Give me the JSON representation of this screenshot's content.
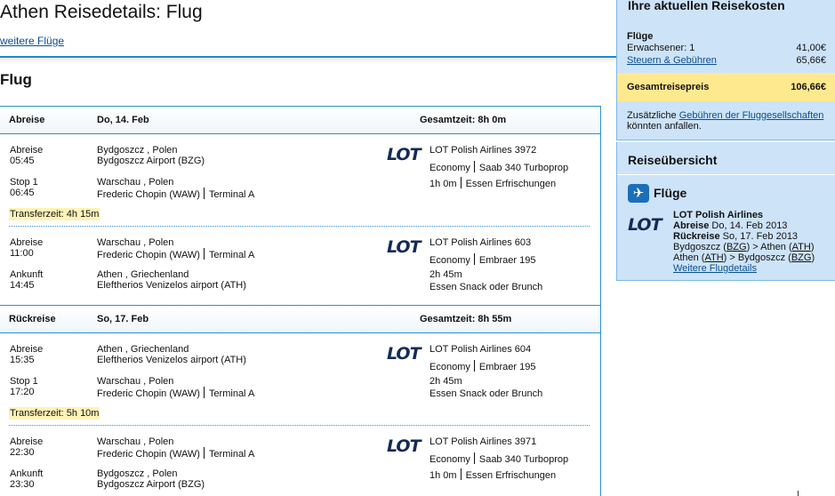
{
  "page": {
    "title": "Athen Reisedetails: Flug",
    "more_flights": "weitere Flüge",
    "section_title": "Flug"
  },
  "outbound": {
    "header": {
      "type": "Abreise",
      "date": "Do, 14. Feb",
      "total": "Gesamtzeit: 8h 0m"
    },
    "segments": [
      {
        "from_label": "Abreise",
        "from_time": "05:45",
        "from_city": "Bydgoszcz , Polen",
        "from_airport": "Bydgoszcz Airport (BZG)",
        "from_terminal": "",
        "to_label": "Stop 1",
        "to_time": "06:45",
        "to_city": "Warschau , Polen",
        "to_airport": "Frederic Chopin (WAW)",
        "to_terminal": "Terminal A",
        "airline": "LOT",
        "flight": "LOT Polish Airlines 3972",
        "class": "Economy",
        "aircraft": "Saab 340 Turboprop",
        "duration": "1h 0m",
        "meal": "Essen Erfrischungen"
      },
      {
        "from_label": "Abreise",
        "from_time": "11:00",
        "from_city": "Warschau , Polen",
        "from_airport": "Frederic Chopin (WAW)",
        "from_terminal": "Terminal A",
        "to_label": "Ankunft",
        "to_time": "14:45",
        "to_city": "Athen , Griechenland",
        "to_airport": "Eleftherios Venizelos airport (ATH)",
        "to_terminal": "",
        "airline": "LOT",
        "flight": "LOT Polish Airlines 603",
        "class": "Economy",
        "aircraft": "Embraer 195",
        "duration": "2h 45m",
        "meal": "Essen Snack oder Brunch"
      }
    ],
    "transfer": "Transferzeit: 4h 15m"
  },
  "return": {
    "header": {
      "type": "Rückreise",
      "date": "So, 17. Feb",
      "total": "Gesamtzeit: 8h 55m"
    },
    "segments": [
      {
        "from_label": "Abreise",
        "from_time": "15:35",
        "from_city": "Athen , Griechenland",
        "from_airport": "Eleftherios Venizelos airport (ATH)",
        "from_terminal": "",
        "to_label": "Stop 1",
        "to_time": "17:20",
        "to_city": "Warschau , Polen",
        "to_airport": "Frederic Chopin (WAW)",
        "to_terminal": "Terminal A",
        "airline": "LOT",
        "flight": "LOT Polish Airlines 604",
        "class": "Economy",
        "aircraft": "Embraer 195",
        "duration": "2h 45m",
        "meal": "Essen Snack oder Brunch"
      },
      {
        "from_label": "Abreise",
        "from_time": "22:30",
        "from_city": "Warschau , Polen",
        "from_airport": "Frederic Chopin (WAW)",
        "from_terminal": "Terminal A",
        "to_label": "Ankunft",
        "to_time": "23:30",
        "to_city": "Bydgoszcz , Polen",
        "to_airport": "Bydgoszcz Airport (BZG)",
        "to_terminal": "",
        "airline": "LOT",
        "flight": "LOT Polish Airlines 3971",
        "class": "Economy",
        "aircraft": "Saab 340 Turboprop",
        "duration": "1h 0m",
        "meal": "Essen Erfrischungen"
      }
    ],
    "transfer": "Transferzeit: 5h 10m"
  },
  "costs": {
    "title": "Ihre aktuellen Reisekosten",
    "flights_heading": "Flüge",
    "adults_label": "Erwachsener: 1",
    "adults_value": "41,00€",
    "taxes_link": "Steuern & Gebühren",
    "taxes_value": "65,66€",
    "total_label": "Gesamtreisepreis",
    "total_value": "106,66€",
    "extra_prefix": "Zusätzliche",
    "extra_link": "Gebühren der Fluggesellschaften",
    "extra_suffix": "könnten anfallen."
  },
  "overview": {
    "title": "Reiseübersicht",
    "flights_label": "Flüge",
    "airline_logo": "LOT",
    "airline_name": "LOT Polish Airlines",
    "depart_label": "Abreise",
    "depart_date": "Do, 14. Feb 2013",
    "return_label": "Rückreise",
    "return_date": "So, 17. Feb 2013",
    "route1_from": "Bydgoszcz",
    "route1_from_code": "BZG",
    "route1_to": "Athen",
    "route1_to_code": "ATH",
    "route2_from": "Athen",
    "route2_from_code": "ATH",
    "route2_to": "Bydgoszcz",
    "route2_to_code": "BZG",
    "details_link": "Weitere Flugdetails"
  },
  "icons": {
    "plane": "airplane-icon",
    "logo": "lot-logo"
  },
  "colors": {
    "accent": "#2e8fcf",
    "link": "#0a4f8f",
    "panel": "#cde3f8",
    "total": "#ffe98f",
    "transfer": "#fff3b8",
    "logo": "#142a57"
  }
}
